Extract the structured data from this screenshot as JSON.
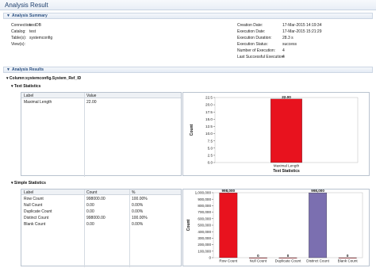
{
  "title": "Analysis Result",
  "summary": {
    "header": "Analysis Summary",
    "left": [
      {
        "label": "Connection:",
        "value": "testDB"
      },
      {
        "label": "Catalog:",
        "value": "test"
      },
      {
        "label": "Table(s):",
        "value": "systemconfig"
      },
      {
        "label": "View(s):",
        "value": ""
      }
    ],
    "right": [
      {
        "label": "Creation Date:",
        "value": "17-Mar-2015 14:19:34"
      },
      {
        "label": "Execution Date:",
        "value": "17-Mar-2015 15:21:29"
      },
      {
        "label": "Execution Duration:",
        "value": "28.3 s"
      },
      {
        "label": "Execution Status:",
        "value": "success"
      },
      {
        "label": "Number of Execution:",
        "value": "4"
      },
      {
        "label": "Last Successful Execution:",
        "value": "4"
      }
    ]
  },
  "results": {
    "header": "Analysis Results",
    "column": "Column:systemconfig.System_Ref_ID",
    "text_stats": {
      "header": "Text Statistics",
      "columns": [
        "Label",
        "Value"
      ],
      "rows": [
        [
          "Maximal Length",
          "22.00"
        ]
      ]
    },
    "simple_stats": {
      "header": "Simple Statistics",
      "columns": [
        "Label",
        "Count",
        "%"
      ],
      "rows": [
        [
          "Row Count",
          "998000.00",
          "100.00%"
        ],
        [
          "Null Count",
          "0.00",
          "0.00%"
        ],
        [
          "Duplicate Count",
          "0.00",
          "0.00%"
        ],
        [
          "Distinct Count",
          "998000.00",
          "100.00%"
        ],
        [
          "Blank Count",
          "0.00",
          "0.00%"
        ]
      ]
    }
  },
  "chart_data": [
    {
      "type": "bar",
      "title": "",
      "xlabel": "Text Statistics",
      "ylabel": "Count",
      "categories": [
        "Maximal Length"
      ],
      "values": [
        22
      ],
      "value_labels": [
        "22.00"
      ],
      "colors": [
        "#e8121e"
      ],
      "ylim": [
        0,
        22.5
      ],
      "yticks": [
        "0.0",
        "2.5",
        "5.0",
        "7.5",
        "10.0",
        "12.5",
        "15.0",
        "17.5",
        "20.0",
        "22.5"
      ],
      "grid": false
    },
    {
      "type": "bar",
      "title": "",
      "xlabel": "",
      "ylabel": "Count",
      "categories": [
        "Row Count",
        "Null Count",
        "Duplicate Count",
        "Distinct Count",
        "Blank Count"
      ],
      "values": [
        998000,
        0,
        0,
        998000,
        0
      ],
      "value_labels": [
        "998,000",
        "0",
        "0",
        "998,000",
        "0"
      ],
      "colors": [
        "#e8121e",
        "#e8121e",
        "#e8121e",
        "#7b6fb0",
        "#e8121e"
      ],
      "ylim": [
        0,
        1000000
      ],
      "yticks": [
        "0",
        "100,000",
        "200,000",
        "300,000",
        "400,000",
        "500,000",
        "600,000",
        "700,000",
        "800,000",
        "900,000",
        "1,000,000"
      ],
      "grid": false
    }
  ]
}
